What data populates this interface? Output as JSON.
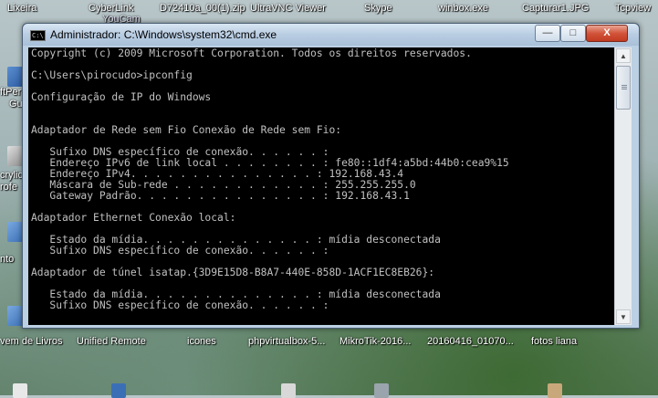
{
  "desktop": {
    "top_labels": [
      "Lixeira",
      "CyberLink",
      "D72410a_00(1).zip",
      "UltraVNC Viewer",
      "Skype",
      "winbox.exe",
      "Capturar1.JPG",
      "Tcpview"
    ],
    "top_sublabel": "YouCam",
    "left_fragments": [
      "ftPer",
      "Gu",
      "crylic",
      "rofe",
      "nto"
    ],
    "bottom_labels": [
      "vem de Livros",
      "Unified Remote",
      "icones",
      "phpvirtualbox-5...",
      "MikroTik-2016...",
      "20160416_01070...",
      "fotos liana"
    ]
  },
  "window": {
    "title": "Administrador: C:\\Windows\\system32\\cmd.exe",
    "icon_text": "C:\\",
    "min_label": "—",
    "max_label": "□",
    "close_label": "X"
  },
  "console": {
    "text": "Copyright (c) 2009 Microsoft Corporation. Todos os direitos reservados.\n\nC:\\Users\\pirocudo>ipconfig\n\nConfiguração de IP do Windows\n\n\nAdaptador de Rede sem Fio Conexão de Rede sem Fio:\n\n   Sufixo DNS específico de conexão. . . . . . :\n   Endereço IPv6 de link local . . . . . . . . : fe80::1df4:a5bd:44b0:cea9%15\n   Endereço IPv4. . . . . . . . . . . . . . . : 192.168.43.4\n   Máscara de Sub-rede . . . . . . . . . . . . : 255.255.255.0\n   Gateway Padrão. . . . . . . . . . . . . . . : 192.168.43.1\n\nAdaptador Ethernet Conexão local:\n\n   Estado da mídia. . . . . . . . . . . . . . : mídia desconectada\n   Sufixo DNS específico de conexão. . . . . . :\n\nAdaptador de túnel isatap.{3D9E15D8-B8A7-440E-858D-1ACF1EC8EB26}:\n\n   Estado da mídia. . . . . . . . . . . . . . : mídia desconectada\n   Sufixo DNS específico de conexão. . . . . . :"
  },
  "colors": {
    "console_bg": "#000000",
    "console_fg": "#c0c0c0",
    "close_button": "#c94a30"
  }
}
